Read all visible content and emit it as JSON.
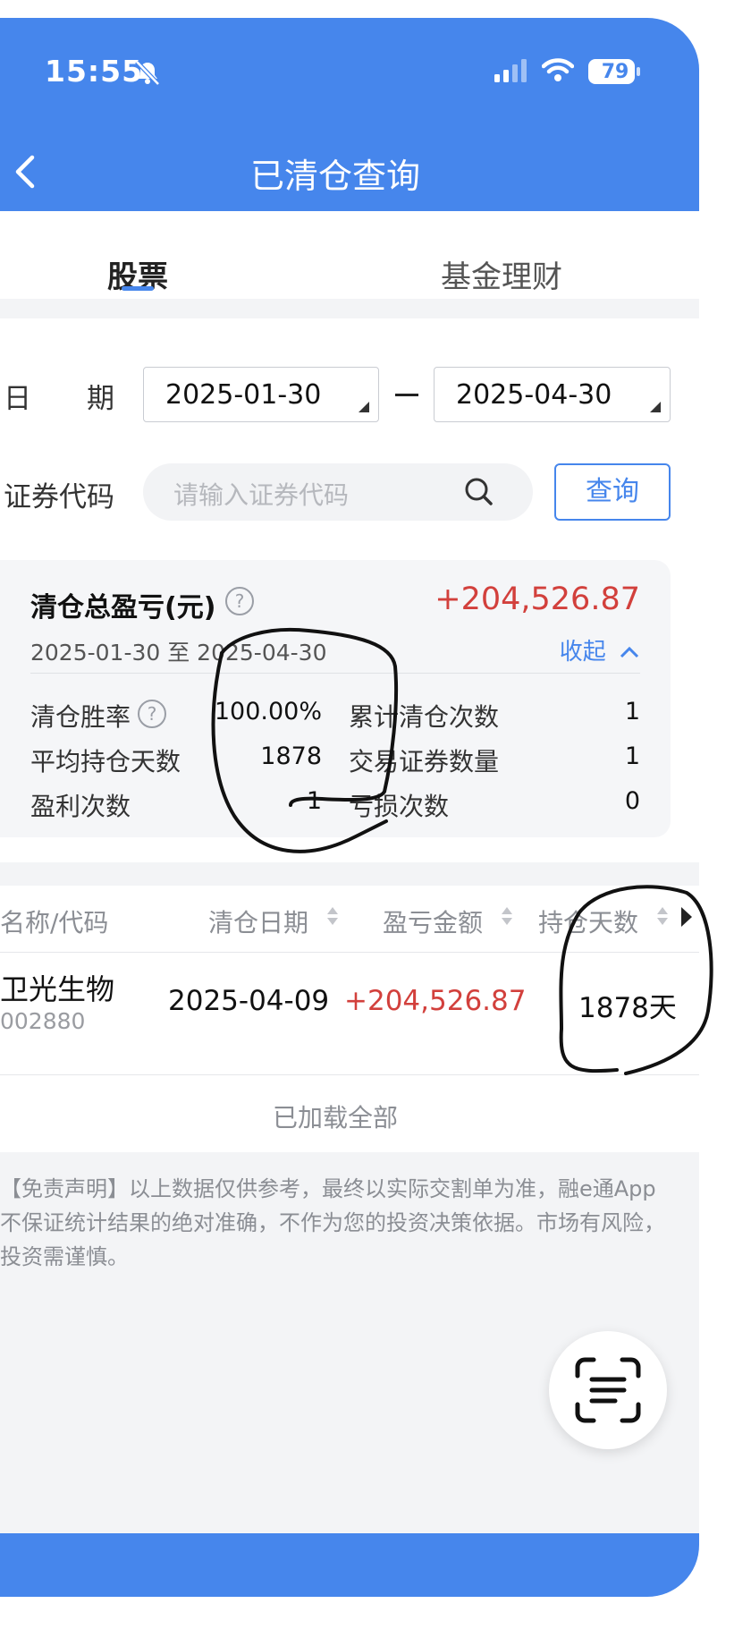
{
  "status_bar": {
    "time": "15:55",
    "battery": "79"
  },
  "header": {
    "title": "已清仓查询"
  },
  "tabs": [
    {
      "label": "股票"
    },
    {
      "label": "基金理财"
    }
  ],
  "filter": {
    "date_label": "日　　期",
    "start_date": "2025-01-30",
    "end_date": "2025-04-30",
    "code_label": "证券代码",
    "code_placeholder": "请输入证券代码",
    "query_button": "查询"
  },
  "summary": {
    "title": "清仓总盈亏(元)",
    "total_pl": "+204,526.87",
    "range": "2025-01-30 至 2025-04-30",
    "collapse": "收起",
    "stats": {
      "win_rate_label": "清仓胜率",
      "win_rate": "100.00%",
      "total_clear_label": "累计清仓次数",
      "total_clear": "1",
      "avg_days_label": "平均持仓天数",
      "avg_days": "1878",
      "securities_label": "交易证券数量",
      "securities": "1",
      "profit_count_label": "盈利次数",
      "profit_count": "1",
      "loss_count_label": "亏损次数",
      "loss_count": "0"
    }
  },
  "table": {
    "columns": [
      "名称/代码",
      "清仓日期",
      "盈亏金额",
      "持仓天数"
    ],
    "rows": [
      {
        "name": "卫光生物",
        "code": "002880",
        "date": "2025-04-09",
        "pl": "+204,526.87",
        "days": "1878天"
      }
    ],
    "loaded_text": "已加载全部"
  },
  "disclaimer": "【免责声明】以上数据仅供参考，最终以实际交割单为准，融e通App不保证统计结果的绝对准确，不作为您的投资决策依据。市场有风险，投资需谨慎。",
  "colors": {
    "primary": "#4686ec",
    "profit": "#d2403c"
  },
  "icons": [
    "bell-slash-icon",
    "signal-icon",
    "wifi-icon",
    "battery-icon",
    "back-chevron-icon",
    "search-icon",
    "help-icon",
    "chevron-up-icon",
    "sort-icon",
    "scan-text-icon"
  ]
}
